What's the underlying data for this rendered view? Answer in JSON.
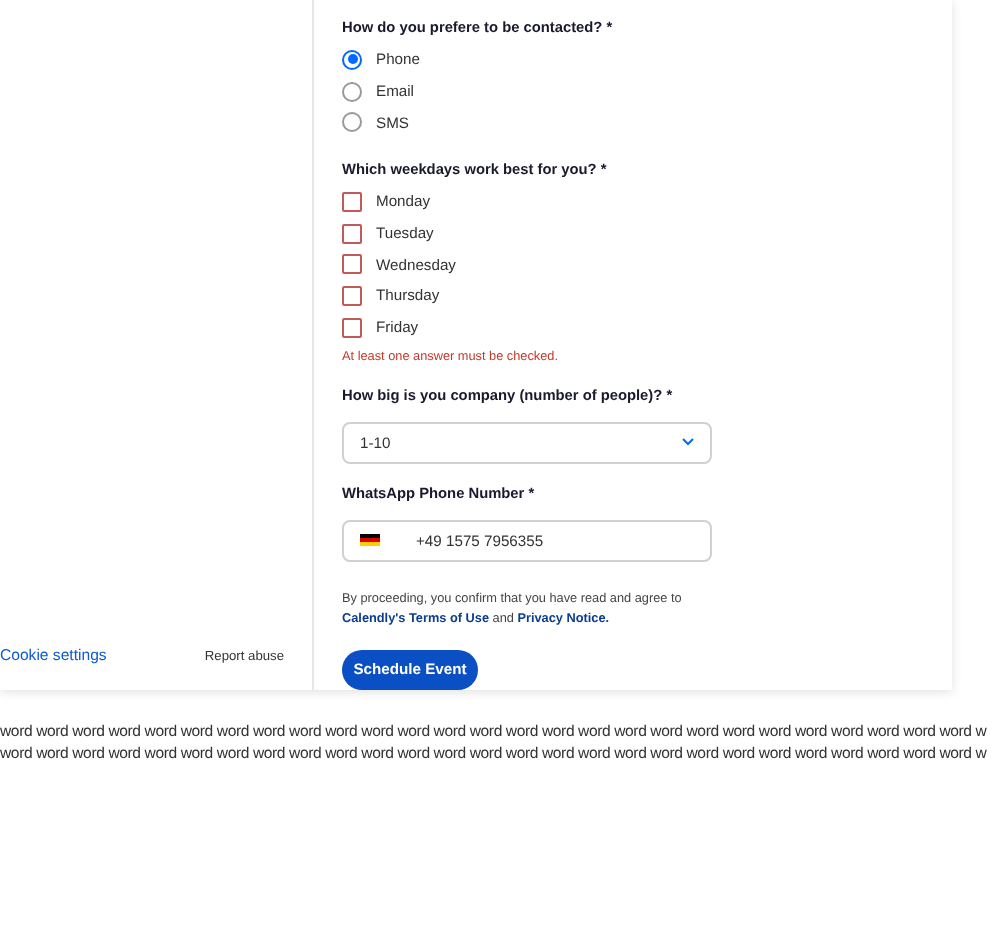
{
  "sidebar": {
    "links": [
      {
        "label": "Cookie settings",
        "kind": "primary"
      },
      {
        "label": "Report abuse",
        "kind": "plain"
      }
    ]
  },
  "contact_question": {
    "label": "How do you prefere to be contacted? *",
    "options": [
      {
        "label": "Phone",
        "selected": true
      },
      {
        "label": "Email",
        "selected": false
      },
      {
        "label": "SMS",
        "selected": false
      }
    ]
  },
  "weekdays_question": {
    "label": "Which weekdays work best for you? *",
    "options": [
      {
        "label": "Monday",
        "checked": false
      },
      {
        "label": "Tuesday",
        "checked": false
      },
      {
        "label": "Wednesday",
        "checked": false
      },
      {
        "label": "Thursday",
        "checked": false
      },
      {
        "label": "Friday",
        "checked": false
      }
    ],
    "error": "At least one answer must be checked."
  },
  "company_size": {
    "label": "How big is you company (number of people)? *",
    "value": "1-10"
  },
  "whatsapp": {
    "label": "WhatsApp Phone Number *",
    "value": "+49 1575 7956355"
  },
  "consent": "By proceeding, you confirm that you have read and agree to **Calendly's Terms of Use** and **Privacy Notice.**",
  "submit": "Schedule Event",
  "filler_lines": [
    "word word word word word word word word word word word word word word word word word word word word word word word word word word word w",
    "word word word word word word word word word word word word word word word word word word word word word word word word word word word w"
  ]
}
